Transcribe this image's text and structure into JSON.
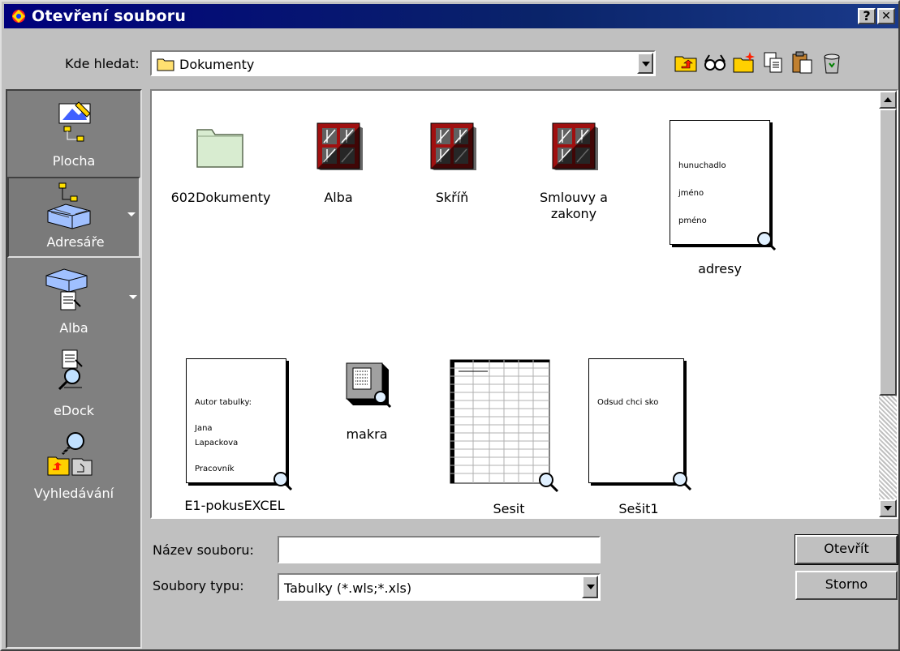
{
  "window": {
    "title": "Otevření souboru",
    "help_label": "?",
    "close_label": "✕"
  },
  "lookin": {
    "label": "Kde hledat:",
    "value": "Dokumenty"
  },
  "toolbar": {
    "icons": [
      "up-one-level-icon",
      "search-web-icon",
      "new-folder-icon",
      "copy-icon",
      "paste-icon",
      "delete-icon"
    ]
  },
  "sidebar": {
    "items": [
      {
        "label": "Plocha"
      },
      {
        "label": "Adresáře"
      },
      {
        "label": "Alba"
      },
      {
        "label": "eDock"
      },
      {
        "label": "Vyhledávání"
      }
    ]
  },
  "files": [
    {
      "name": "602Dokumenty"
    },
    {
      "name": "Alba"
    },
    {
      "name": "Skříň"
    },
    {
      "name": "Smlouvy a zakony"
    },
    {
      "name": "adresy",
      "preview": [
        "hunuchadlo",
        "jméno",
        "pméno"
      ]
    },
    {
      "name": "E1-pokusEXCEL",
      "preview": [
        "Autor tabulky:",
        "Jana",
        "Lapackova",
        "Pracovník"
      ]
    },
    {
      "name": "makra"
    },
    {
      "name": "Sesit"
    },
    {
      "name": "Sešit1",
      "preview": [
        "Odsud chci sko"
      ]
    }
  ],
  "filename": {
    "label": "Název souboru:",
    "value": ""
  },
  "filetype": {
    "label": "Soubory typu:",
    "value": "Tabulky (*.wls;*.xls)"
  },
  "buttons": {
    "open": "Otevřít",
    "cancel": "Storno"
  }
}
